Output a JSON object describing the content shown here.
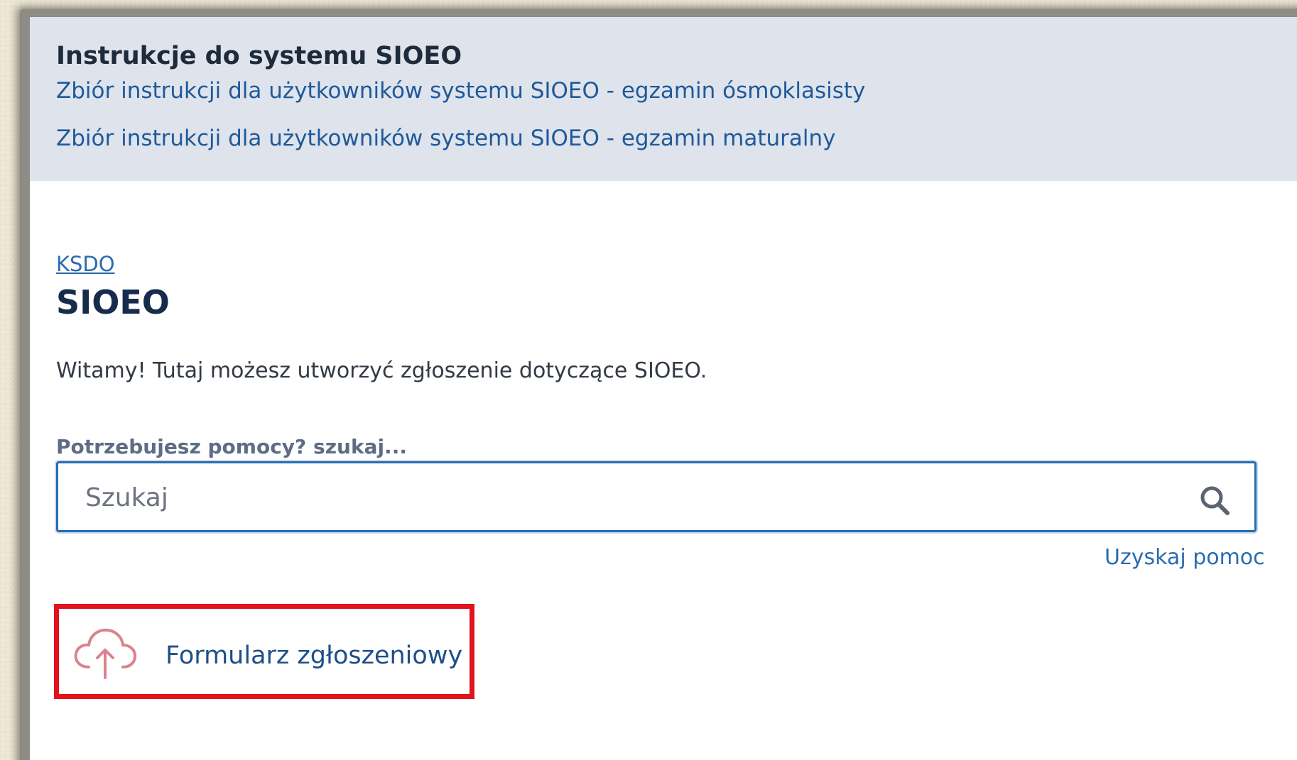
{
  "banner": {
    "title": "Instrukcje do systemu SIOEO",
    "links": [
      "Zbiór instrukcji dla użytkowników systemu SIOEO - egzamin ósmoklasisty",
      "Zbiór instrukcji dla użytkowników systemu SIOEO - egzamin maturalny"
    ]
  },
  "breadcrumb": "KSDO",
  "page_title": "SIOEO",
  "welcome_text": "Witamy! Tutaj możesz utworzyć zgłoszenie dotyczące SIOEO.",
  "search": {
    "label": "Potrzebujesz pomocy? szukaj...",
    "placeholder": "Szukaj",
    "icon": "search-icon"
  },
  "help_link": "Uzyskaj pomoc",
  "request_form": {
    "label": "Formularz zgłoszeniowy",
    "icon": "cloud-upload-icon",
    "highlight_color": "#e0141e"
  }
}
